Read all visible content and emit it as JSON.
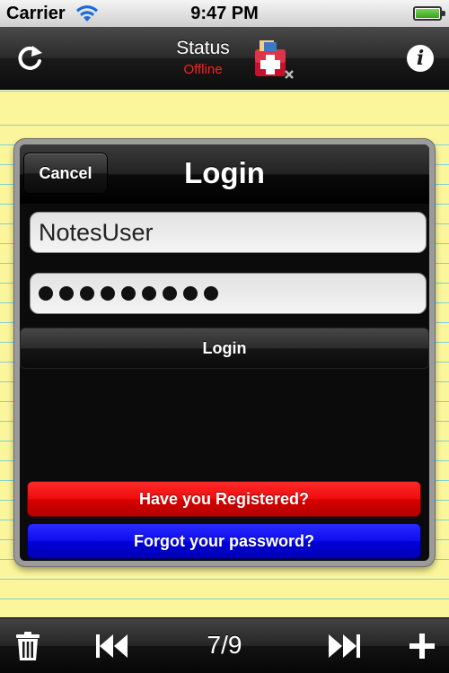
{
  "status_bar": {
    "carrier": "Carrier",
    "time": "9:47 PM"
  },
  "nav": {
    "status_label": "Status",
    "status_value": "Offline",
    "status_color": "#ff2020",
    "left_icon": "refresh-icon",
    "right_icon": "info-icon",
    "info_glyph": "i"
  },
  "dialog": {
    "title": "Login",
    "cancel_label": "Cancel",
    "username_value": "NotesUser",
    "password_dot_count": 9,
    "login_label": "Login",
    "registered_label": "Have you Registered?",
    "forgot_label": "Forgot your password?",
    "registered_color": "#ee0c0c",
    "forgot_color": "#0c0cee"
  },
  "toolbar": {
    "page_indicator": "7/9",
    "icons": [
      "trash-icon",
      "skip-back-icon",
      "skip-forward-icon",
      "plus-icon"
    ]
  },
  "notepad": {
    "paper_color": "#fbf59b",
    "line_color": "#7fd3d6"
  }
}
